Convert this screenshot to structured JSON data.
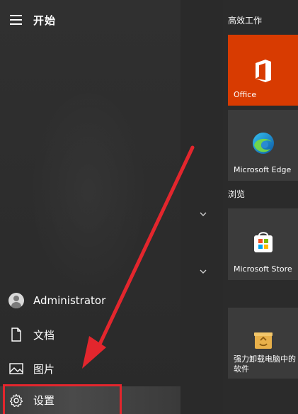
{
  "start_menu": {
    "title": "开始",
    "nav": {
      "user_label": "Administrator",
      "documents_label": "文档",
      "pictures_label": "图片",
      "settings_label": "设置"
    },
    "groups": [
      {
        "title": "高效工作"
      },
      {
        "title": "浏览"
      }
    ],
    "tiles": {
      "office": {
        "label": "Office",
        "icon": "office-icon",
        "color": "#d83b01"
      },
      "edge": {
        "label": "Microsoft Edge",
        "icon": "edge-icon"
      },
      "store": {
        "label": "Microsoft Store",
        "icon": "store-icon"
      },
      "uninstaller": {
        "label": "强力卸载电脑中的软件",
        "icon": "uninstaller-icon"
      }
    }
  },
  "annotation": {
    "highlight_color": "#e3262d",
    "highlight_target": "settings"
  }
}
